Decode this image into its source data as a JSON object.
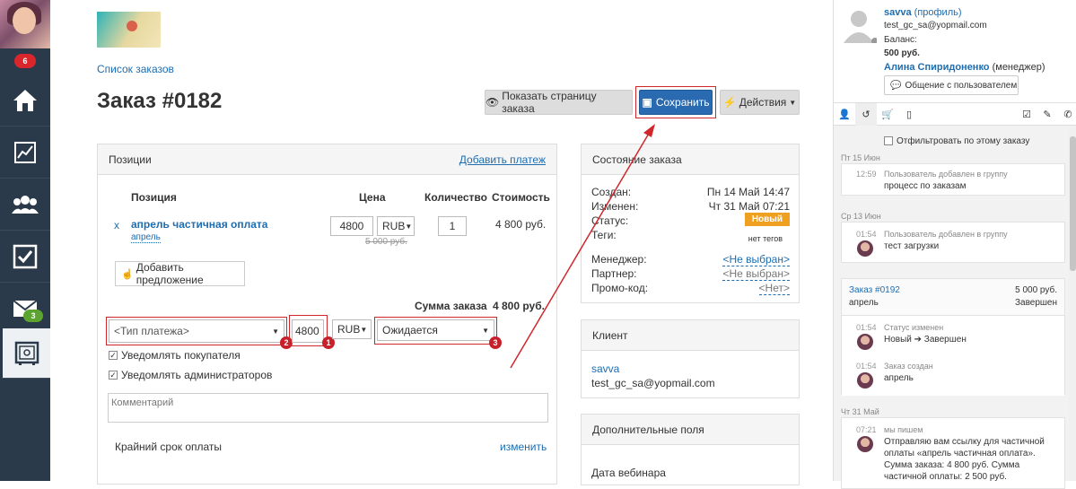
{
  "sidebar": {
    "notification_count": "6",
    "mail_count": "3",
    "items": [
      {
        "name": "home-icon"
      },
      {
        "name": "chart-icon"
      },
      {
        "name": "users-icon"
      },
      {
        "name": "tasks-icon"
      },
      {
        "name": "mail-icon"
      },
      {
        "name": "safe-icon"
      }
    ]
  },
  "page": {
    "breadcrumb": "Список заказов",
    "title": "Заказ #0182",
    "show_order_page_label": "Показать страницу заказа",
    "save_label": "Сохранить",
    "actions_label": "Действия"
  },
  "positions": {
    "header": "Позиции",
    "add_payment": "Добавить платеж",
    "columns": [
      "Позиция",
      "Цена",
      "Количество",
      "Стоимость"
    ],
    "row": {
      "remove": "x",
      "name": "апрель частичная оплата",
      "sub": "апрель",
      "price": "4800",
      "currency": "RUB",
      "old_price": "5 000 руб.",
      "quantity": "1",
      "cost": "4 800 руб."
    },
    "add_offer": "Добавить предложение",
    "sum_label": "Сумма заказа",
    "sum_value": "4 800 руб."
  },
  "payment": {
    "type_placeholder": "<Тип платежа>",
    "amount": "4800",
    "currency": "RUB",
    "status": "Ожидается",
    "markers": [
      "2",
      "1",
      "3"
    ],
    "notify_buyer": "Уведомлять покупателя",
    "notify_admins": "Уведомлять администраторов",
    "comment_placeholder": "Комментарий",
    "deadline_label": "Крайний срок оплаты",
    "change_label": "изменить"
  },
  "state": {
    "header": "Состояние заказа",
    "rows": [
      {
        "label": "Создан:",
        "value": "Пн 14 Май 14:47"
      },
      {
        "label": "Изменен:",
        "value": "Чт 31 Май 07:21"
      },
      {
        "label": "Статус:",
        "value": "Новый"
      },
      {
        "label": "Теги:",
        "value": "нет тегов"
      },
      {
        "label": "Менеджер:",
        "value": "<Не выбран>"
      },
      {
        "label": "Партнер:",
        "value": "<Не выбран>"
      },
      {
        "label": "Промо-код:",
        "value": "<Нет>"
      }
    ],
    "status_color": "#f0a020"
  },
  "client": {
    "header": "Клиент",
    "name": "savva",
    "email": "test_gc_sa@yopmail.com"
  },
  "extra": {
    "header": "Дополнительные поля",
    "field": "Дата вебинара"
  },
  "user": {
    "name": "savva",
    "profile": "(профиль)",
    "email": "test_gc_sa@yopmail.com",
    "balance_label": "Баланс:",
    "balance": "500 руб.",
    "manager_name": "Алина Спиридоненко",
    "manager_role": "(менеджер)",
    "chat_button": "Общение с пользователем",
    "filter_label": "Отфильтровать по этому заказу"
  },
  "feed": {
    "date1": "Пт 15 Июн",
    "e1_time": "12:59",
    "e1_title": "Пользователь добавлен в группу",
    "e1_text": "процесс по заказам",
    "date2": "Ср 13 Июн",
    "e2_time": "01:54",
    "e2_title": "Пользователь добавлен в группу",
    "e2_text": "тест загрузки",
    "order_link": "Заказ #0192",
    "order_amount": "5 000 руб.",
    "order_name": "апрель",
    "order_status": "Завершен",
    "e3_time": "01:54",
    "e3_title": "Статус изменен",
    "e3_text": "Новый ➔ Завершен",
    "e4_time": "01:54",
    "e4_title": "Заказ создан",
    "e4_text": "апрель",
    "date3": "Чт 31 Май",
    "e5_time": "07:21",
    "e5_title": "мы пишем",
    "e5_lines": [
      "Отправляю вам ссылку для частичной",
      "оплаты «апрель частичная оплата».",
      "Сумма заказа: 4 800 руб. Сумма",
      "частичной оплаты: 2 500 руб."
    ]
  }
}
